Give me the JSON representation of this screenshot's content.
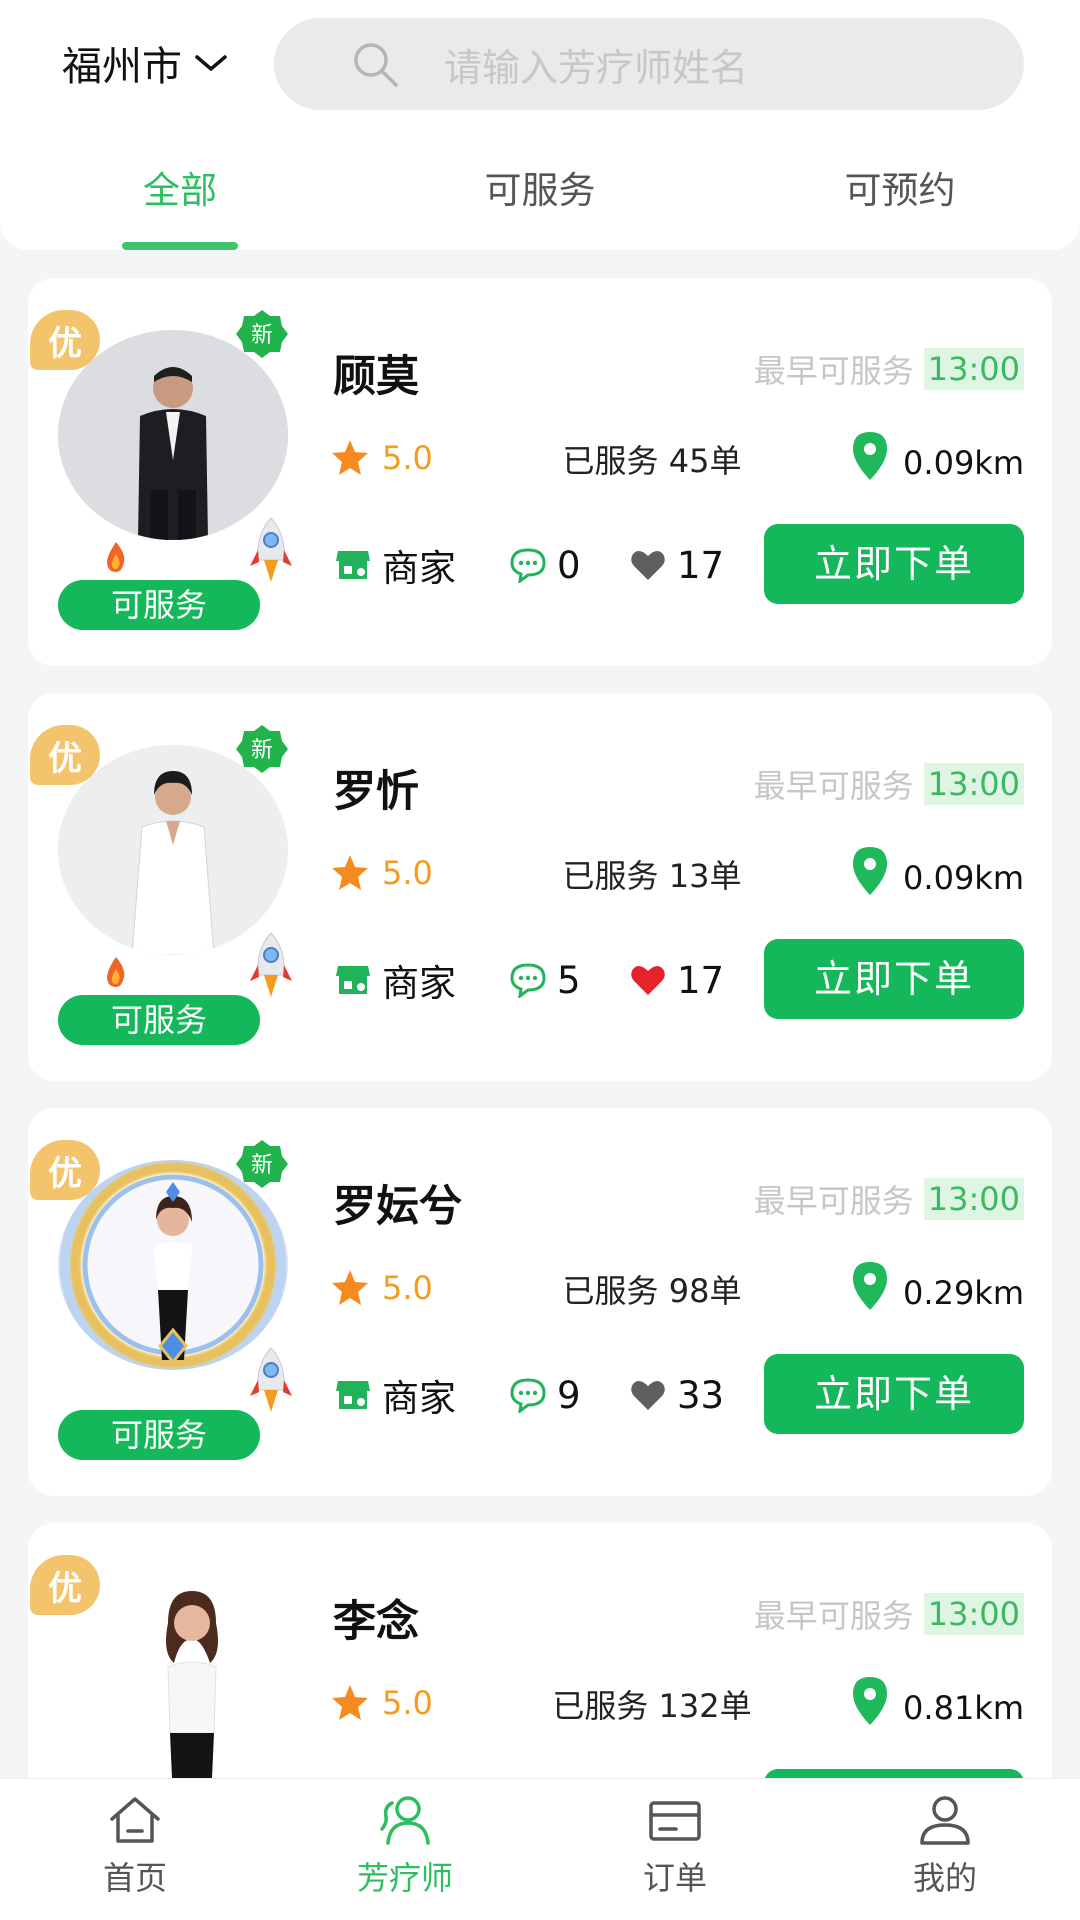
{
  "header": {
    "city": "福州市",
    "search_placeholder": "请输入芳疗师姓名",
    "tabs": [
      {
        "label": "全部",
        "active": true
      },
      {
        "label": "可服务",
        "active": false
      },
      {
        "label": "可预约",
        "active": false
      }
    ]
  },
  "common": {
    "badge_you": "优",
    "badge_new": "新",
    "status_label": "可服务",
    "earliest_label": "最早可服务",
    "shop_label": "商家",
    "order_button": "立即下单"
  },
  "therapists": [
    {
      "name": "顾莫",
      "earliest_time": "13:00",
      "rating": "5.0",
      "served": "已服务 45单",
      "distance": "0.09km",
      "comments": "0",
      "likes": "17",
      "liked": false,
      "is_new": true
    },
    {
      "name": "罗忻",
      "earliest_time": "13:00",
      "rating": "5.0",
      "served": "已服务 13单",
      "distance": "0.09km",
      "comments": "5",
      "likes": "17",
      "liked": true,
      "is_new": true
    },
    {
      "name": "罗妘兮",
      "earliest_time": "13:00",
      "rating": "5.0",
      "served": "已服务 98单",
      "distance": "0.29km",
      "comments": "9",
      "likes": "33",
      "liked": false,
      "is_new": true
    },
    {
      "name": "李念",
      "earliest_time": "13:00",
      "rating": "5.0",
      "served": "已服务 132单",
      "distance": "0.81km",
      "is_new": false
    }
  ],
  "bottom_nav": [
    {
      "label": "首页",
      "icon": "home-icon",
      "active": false
    },
    {
      "label": "芳疗师",
      "icon": "therapist-icon",
      "active": true
    },
    {
      "label": "订单",
      "icon": "order-icon",
      "active": false
    },
    {
      "label": "我的",
      "icon": "profile-icon",
      "active": false
    }
  ],
  "colors": {
    "primary_green": "#14b85a",
    "tab_active": "#2dbf5f",
    "rating_orange": "#f39c1f",
    "like_red": "#e8222a",
    "badge_gold": "#f3c46b"
  }
}
